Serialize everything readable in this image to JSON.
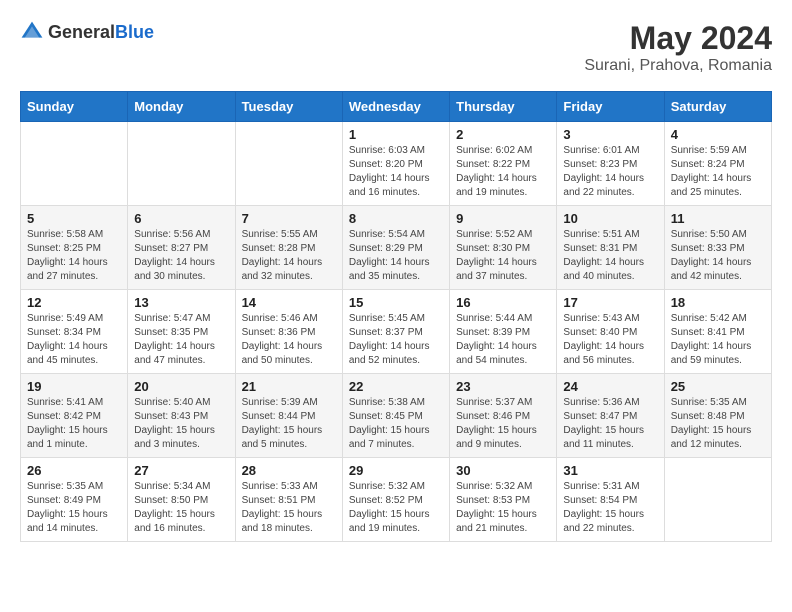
{
  "logo": {
    "general": "General",
    "blue": "Blue"
  },
  "title": "May 2024",
  "location": "Surani, Prahova, Romania",
  "days_of_week": [
    "Sunday",
    "Monday",
    "Tuesday",
    "Wednesday",
    "Thursday",
    "Friday",
    "Saturday"
  ],
  "weeks": [
    [
      {
        "day": "",
        "info": ""
      },
      {
        "day": "",
        "info": ""
      },
      {
        "day": "",
        "info": ""
      },
      {
        "day": "1",
        "info": "Sunrise: 6:03 AM\nSunset: 8:20 PM\nDaylight: 14 hours and 16 minutes."
      },
      {
        "day": "2",
        "info": "Sunrise: 6:02 AM\nSunset: 8:22 PM\nDaylight: 14 hours and 19 minutes."
      },
      {
        "day": "3",
        "info": "Sunrise: 6:01 AM\nSunset: 8:23 PM\nDaylight: 14 hours and 22 minutes."
      },
      {
        "day": "4",
        "info": "Sunrise: 5:59 AM\nSunset: 8:24 PM\nDaylight: 14 hours and 25 minutes."
      }
    ],
    [
      {
        "day": "5",
        "info": "Sunrise: 5:58 AM\nSunset: 8:25 PM\nDaylight: 14 hours and 27 minutes."
      },
      {
        "day": "6",
        "info": "Sunrise: 5:56 AM\nSunset: 8:27 PM\nDaylight: 14 hours and 30 minutes."
      },
      {
        "day": "7",
        "info": "Sunrise: 5:55 AM\nSunset: 8:28 PM\nDaylight: 14 hours and 32 minutes."
      },
      {
        "day": "8",
        "info": "Sunrise: 5:54 AM\nSunset: 8:29 PM\nDaylight: 14 hours and 35 minutes."
      },
      {
        "day": "9",
        "info": "Sunrise: 5:52 AM\nSunset: 8:30 PM\nDaylight: 14 hours and 37 minutes."
      },
      {
        "day": "10",
        "info": "Sunrise: 5:51 AM\nSunset: 8:31 PM\nDaylight: 14 hours and 40 minutes."
      },
      {
        "day": "11",
        "info": "Sunrise: 5:50 AM\nSunset: 8:33 PM\nDaylight: 14 hours and 42 minutes."
      }
    ],
    [
      {
        "day": "12",
        "info": "Sunrise: 5:49 AM\nSunset: 8:34 PM\nDaylight: 14 hours and 45 minutes."
      },
      {
        "day": "13",
        "info": "Sunrise: 5:47 AM\nSunset: 8:35 PM\nDaylight: 14 hours and 47 minutes."
      },
      {
        "day": "14",
        "info": "Sunrise: 5:46 AM\nSunset: 8:36 PM\nDaylight: 14 hours and 50 minutes."
      },
      {
        "day": "15",
        "info": "Sunrise: 5:45 AM\nSunset: 8:37 PM\nDaylight: 14 hours and 52 minutes."
      },
      {
        "day": "16",
        "info": "Sunrise: 5:44 AM\nSunset: 8:39 PM\nDaylight: 14 hours and 54 minutes."
      },
      {
        "day": "17",
        "info": "Sunrise: 5:43 AM\nSunset: 8:40 PM\nDaylight: 14 hours and 56 minutes."
      },
      {
        "day": "18",
        "info": "Sunrise: 5:42 AM\nSunset: 8:41 PM\nDaylight: 14 hours and 59 minutes."
      }
    ],
    [
      {
        "day": "19",
        "info": "Sunrise: 5:41 AM\nSunset: 8:42 PM\nDaylight: 15 hours and 1 minute."
      },
      {
        "day": "20",
        "info": "Sunrise: 5:40 AM\nSunset: 8:43 PM\nDaylight: 15 hours and 3 minutes."
      },
      {
        "day": "21",
        "info": "Sunrise: 5:39 AM\nSunset: 8:44 PM\nDaylight: 15 hours and 5 minutes."
      },
      {
        "day": "22",
        "info": "Sunrise: 5:38 AM\nSunset: 8:45 PM\nDaylight: 15 hours and 7 minutes."
      },
      {
        "day": "23",
        "info": "Sunrise: 5:37 AM\nSunset: 8:46 PM\nDaylight: 15 hours and 9 minutes."
      },
      {
        "day": "24",
        "info": "Sunrise: 5:36 AM\nSunset: 8:47 PM\nDaylight: 15 hours and 11 minutes."
      },
      {
        "day": "25",
        "info": "Sunrise: 5:35 AM\nSunset: 8:48 PM\nDaylight: 15 hours and 12 minutes."
      }
    ],
    [
      {
        "day": "26",
        "info": "Sunrise: 5:35 AM\nSunset: 8:49 PM\nDaylight: 15 hours and 14 minutes."
      },
      {
        "day": "27",
        "info": "Sunrise: 5:34 AM\nSunset: 8:50 PM\nDaylight: 15 hours and 16 minutes."
      },
      {
        "day": "28",
        "info": "Sunrise: 5:33 AM\nSunset: 8:51 PM\nDaylight: 15 hours and 18 minutes."
      },
      {
        "day": "29",
        "info": "Sunrise: 5:32 AM\nSunset: 8:52 PM\nDaylight: 15 hours and 19 minutes."
      },
      {
        "day": "30",
        "info": "Sunrise: 5:32 AM\nSunset: 8:53 PM\nDaylight: 15 hours and 21 minutes."
      },
      {
        "day": "31",
        "info": "Sunrise: 5:31 AM\nSunset: 8:54 PM\nDaylight: 15 hours and 22 minutes."
      },
      {
        "day": "",
        "info": ""
      }
    ]
  ]
}
